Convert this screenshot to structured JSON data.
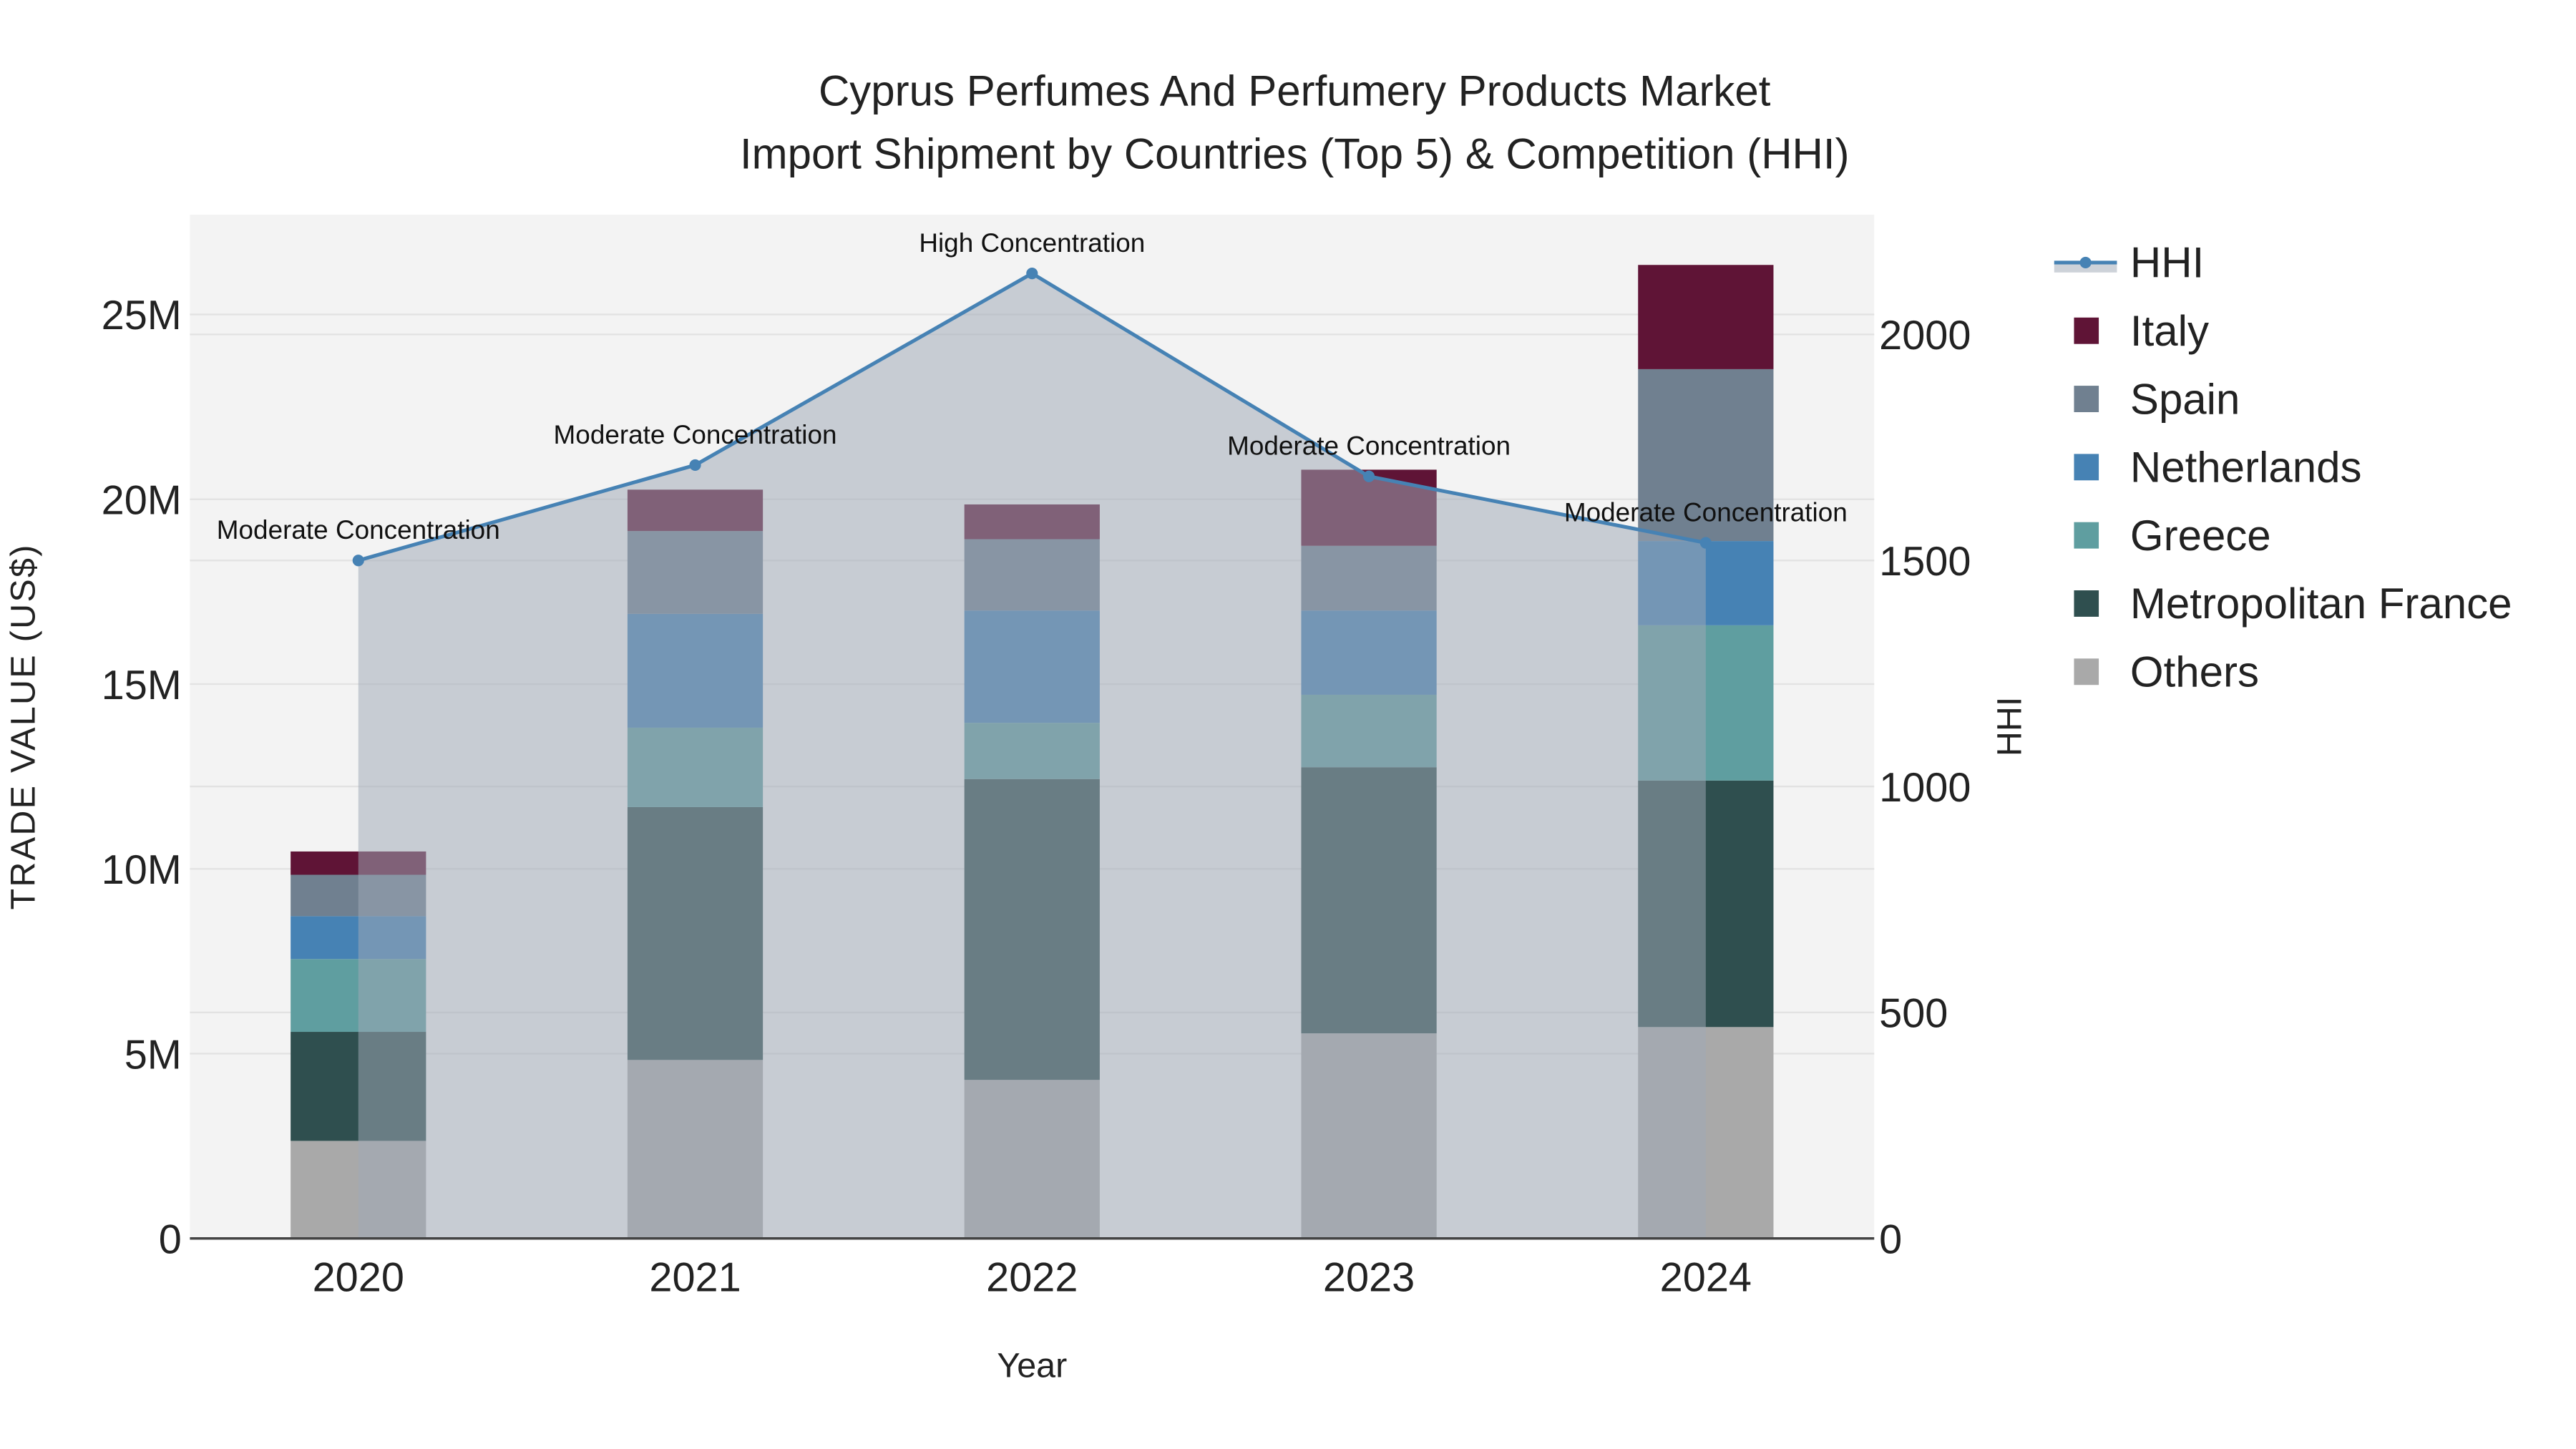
{
  "chart_data": {
    "type": "bar",
    "stacked": true,
    "title": "Cyprus Perfumes And Perfumery Products Market",
    "subtitle": "Import Shipment by Countries (Top 5) & Competition (HHI)",
    "xlabel": "Year",
    "ylabel": "TRADE VALUE (US$)",
    "y2label": "HHI",
    "categories": [
      "2020",
      "2021",
      "2022",
      "2023",
      "2024"
    ],
    "ylim": [
      0,
      27700000
    ],
    "y2lim": [
      0,
      2265
    ],
    "yticks": [
      {
        "v": 0,
        "label": "0"
      },
      {
        "v": 5000000,
        "label": "5M"
      },
      {
        "v": 10000000,
        "label": "10M"
      },
      {
        "v": 15000000,
        "label": "15M"
      },
      {
        "v": 20000000,
        "label": "20M"
      },
      {
        "v": 25000000,
        "label": "25M"
      }
    ],
    "y2ticks": [
      {
        "v": 0,
        "label": "0"
      },
      {
        "v": 500,
        "label": "500"
      },
      {
        "v": 1000,
        "label": "1000"
      },
      {
        "v": 1500,
        "label": "1500"
      },
      {
        "v": 2000,
        "label": "2000"
      }
    ],
    "series": [
      {
        "name": "Others",
        "color": "#a9a9a9",
        "values": [
          2640000,
          4830000,
          4290000,
          5550000,
          5720000
        ]
      },
      {
        "name": "Metropolitan France",
        "color": "#2f4f4f",
        "values": [
          2950000,
          6840000,
          8140000,
          7200000,
          6670000
        ]
      },
      {
        "name": "Greece",
        "color": "#5f9ea0",
        "values": [
          1970000,
          2150000,
          1520000,
          1960000,
          4200000
        ]
      },
      {
        "name": "Netherlands",
        "color": "#4682b4",
        "values": [
          1160000,
          3080000,
          3040000,
          2280000,
          2280000
        ]
      },
      {
        "name": "Spain",
        "color": "#708090",
        "values": [
          1120000,
          2240000,
          1930000,
          1750000,
          4650000
        ]
      },
      {
        "name": "Italy",
        "color": "#5f1436",
        "values": [
          630000,
          1120000,
          940000,
          2060000,
          2820000
        ]
      }
    ],
    "hhi": {
      "name": "HHI",
      "color": "#4682b4",
      "values": [
        1500,
        1711,
        2135,
        1686,
        1539
      ],
      "annotations": [
        "Moderate Concentration",
        "Moderate Concentration",
        "High Concentration",
        "Moderate Concentration",
        "Moderate Concentration"
      ]
    },
    "legend": [
      "HHI",
      "Italy",
      "Spain",
      "Netherlands",
      "Greece",
      "Metropolitan France",
      "Others"
    ],
    "legend_position": "right",
    "grid": true
  }
}
